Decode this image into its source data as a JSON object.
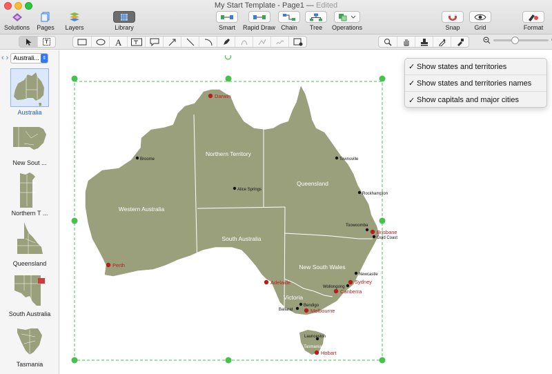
{
  "window": {
    "title": "My Start Template - Page1",
    "status": "Edited"
  },
  "toolbar": {
    "solutions": "Solutions",
    "pages": "Pages",
    "layers": "Layers",
    "library": "Library",
    "smart": "Smart",
    "rapid_draw": "Rapid Draw",
    "chain": "Chain",
    "tree": "Tree",
    "operations": "Operations",
    "snap": "Snap",
    "grid": "Grid",
    "format": "Format"
  },
  "sidebar": {
    "selected_library": "Australi...",
    "items": [
      {
        "label": "Australia"
      },
      {
        "label": "New Sout ..."
      },
      {
        "label": "Northern T ..."
      },
      {
        "label": "Queensland"
      },
      {
        "label": "South Australia"
      },
      {
        "label": "Tasmania"
      }
    ]
  },
  "map": {
    "regions": {
      "wa": "Western Australia",
      "nt": "Northern Territory",
      "qld": "Queensland",
      "sa": "South Australia",
      "nsw": "New South Wales",
      "vic": "Victoria",
      "tas": "Tasmania"
    },
    "capitals": {
      "darwin": "Darwin",
      "perth": "Perth",
      "adelaide": "Adelaide",
      "brisbane": "Brisbane",
      "sydney": "Sydney",
      "canberra": "Canberra",
      "melbourne": "Melbourne",
      "hobart": "Hobart"
    },
    "cities": {
      "broome": "Broome",
      "alice_springs": "Alice Springs",
      "townsville": "Townsville",
      "rockhampton": "Rockhampton",
      "toowoomba": "Toowoomba",
      "gold_coast": "Gold Coast",
      "newcastle": "Newcastle",
      "wollongong": "Wollongong",
      "bendigo": "Bendigo",
      "ballarat": "Ballarat",
      "launceston": "Launceston"
    },
    "land_color": "#9aa07c",
    "capital_color": "#b81c1c"
  },
  "menu": {
    "items": [
      {
        "label": "Show states and territories",
        "checked": "✓"
      },
      {
        "label": "Show states and territories names",
        "checked": "✓"
      },
      {
        "label": "Show capitals and major cities",
        "checked": "✓"
      }
    ]
  }
}
